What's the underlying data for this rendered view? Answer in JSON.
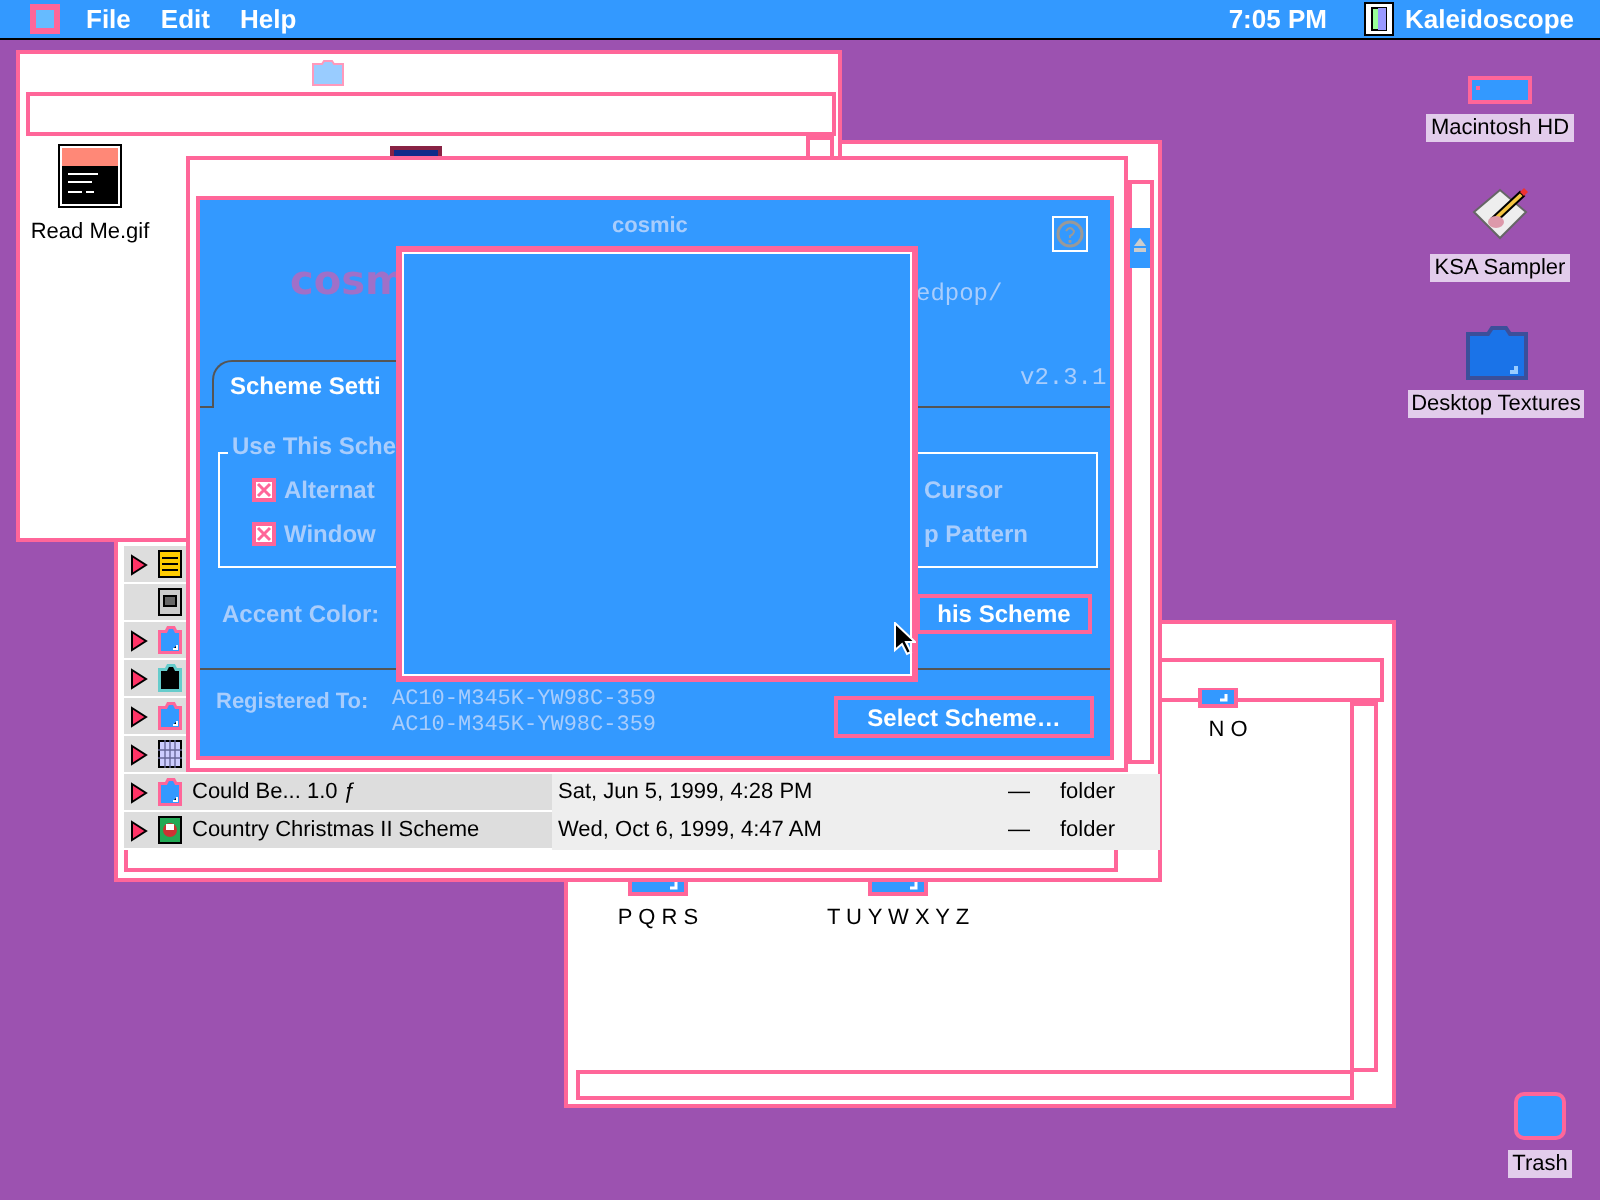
{
  "menu_bar": {
    "menus": [
      {
        "label": "File"
      },
      {
        "label": "Edit"
      },
      {
        "label": "Help"
      }
    ],
    "clock": "7:05 PM",
    "app": "Kaleidoscope"
  },
  "desktop_icons": [
    {
      "label": "Macintosh HD",
      "kind": "drive"
    },
    {
      "label": "KSA Sampler",
      "kind": "app"
    },
    {
      "label": "Desktop Textures",
      "kind": "folder"
    },
    {
      "label": "Trash",
      "kind": "trash"
    }
  ],
  "back_window": {
    "icons": [
      {
        "label": "Read Me.gif",
        "kind": "image"
      }
    ]
  },
  "list_window": {
    "rows": [
      {
        "expandable": true,
        "kind": "stack"
      },
      {
        "expandable": false,
        "kind": "disk"
      },
      {
        "expandable": true,
        "kind": "folder"
      },
      {
        "expandable": true,
        "kind": "dark"
      },
      {
        "expandable": true,
        "kind": "folder"
      },
      {
        "expandable": true,
        "kind": "grid"
      },
      {
        "expandable": true,
        "kind": "folder",
        "name": "Could Be... 1.0 ƒ",
        "date": "Sat, Jun 5, 1999, 4:28 PM",
        "size": "—",
        "type": "folder"
      },
      {
        "expandable": true,
        "kind": "picture",
        "name": "Country Christmas II  Scheme",
        "date": "Wed, Oct 6, 1999, 4:47 AM",
        "size": "—",
        "type": "folder"
      }
    ]
  },
  "icon_window": {
    "icons": [
      {
        "label": "N O"
      },
      {
        "label": "P Q R S"
      },
      {
        "label": "T U Y W X Y Z"
      }
    ]
  },
  "dialog": {
    "title": "cosmic",
    "logo": "cosm",
    "url": "edpop/",
    "version": "v2.3.1",
    "tab": {
      "label": "Scheme Setti",
      "selected": true
    },
    "group_label": "Use This Sche",
    "options": [
      {
        "label": "Alternat",
        "checked": true
      },
      {
        "label": "Window",
        "checked": true
      },
      {
        "label": "Cursor"
      },
      {
        "label": "p Pattern"
      }
    ],
    "accent_label": "Accent Color:",
    "use_button": "his Scheme",
    "registered_label": "Registered To:",
    "codes": [
      "AC10-M345K-YW98C-359",
      "AC10-M345K-YW98C-359"
    ],
    "select_button": "Select Scheme…"
  }
}
